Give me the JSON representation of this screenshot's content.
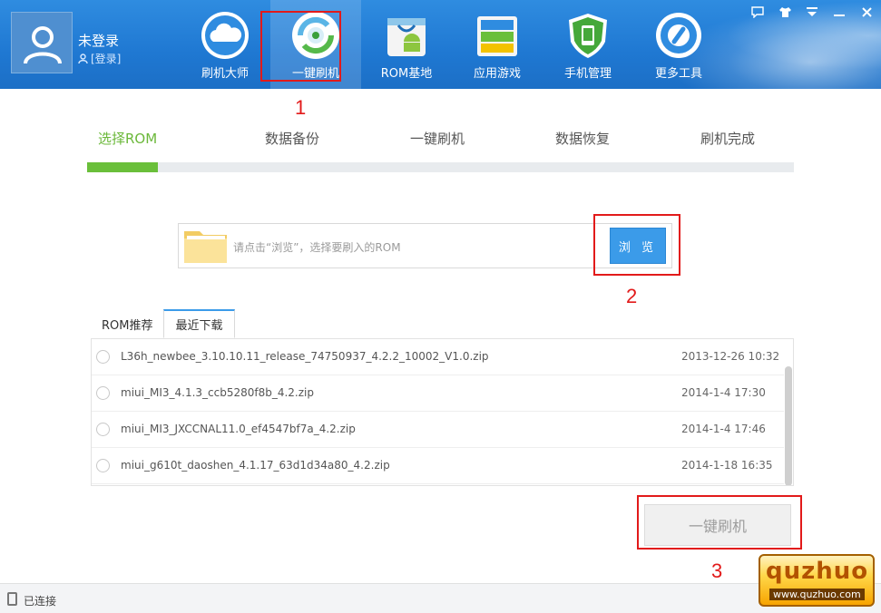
{
  "header": {
    "user_name": "未登录",
    "login_label": "[登录]",
    "nav": [
      {
        "label": "刷机大师",
        "icon": "cloud-icon"
      },
      {
        "label": "一键刷机",
        "icon": "refresh-target-icon"
      },
      {
        "label": "ROM基地",
        "icon": "android-bag-icon"
      },
      {
        "label": "应用游戏",
        "icon": "apps-stack-icon"
      },
      {
        "label": "手机管理",
        "icon": "phone-shield-icon"
      },
      {
        "label": "更多工具",
        "icon": "wrench-gear-icon"
      }
    ]
  },
  "steps": {
    "items": [
      "选择ROM",
      "数据备份",
      "一键刷机",
      "数据恢复",
      "刷机完成"
    ],
    "active_index": 0,
    "progress_fraction": 0.1
  },
  "browse": {
    "placeholder": "请点击“浏览”，选择要刷入的ROM",
    "button_label": "浏 览"
  },
  "tabs": {
    "items": [
      "ROM推荐",
      "最近下载"
    ],
    "active_index": 1
  },
  "files": [
    {
      "name": "L36h_newbee_3.10.10.11_release_74750937_4.2.2_10002_V1.0.zip",
      "date": "2013-12-26 10:32"
    },
    {
      "name": "miui_MI3_4.1.3_ccb5280f8b_4.2.zip",
      "date": "2014-1-4 17:30"
    },
    {
      "name": "miui_MI3_JXCCNAL11.0_ef4547bf7a_4.2.zip",
      "date": "2014-1-4 17:46"
    },
    {
      "name": "miui_g610t_daoshen_4.1.17_63d1d34a80_4.2.zip",
      "date": "2014-1-18 16:35"
    }
  ],
  "flash_button_label": "一键刷机",
  "annotations": [
    "1",
    "2",
    "3"
  ],
  "status": {
    "text": "已连接"
  },
  "watermark": {
    "brand": "quzhuo",
    "url": "www.quzhuo.com"
  },
  "colors": {
    "header_blue": "#1f78d2",
    "progress_green": "#6abf3a",
    "accent_blue": "#3b9be9",
    "annotation_red": "#e21a1a"
  }
}
